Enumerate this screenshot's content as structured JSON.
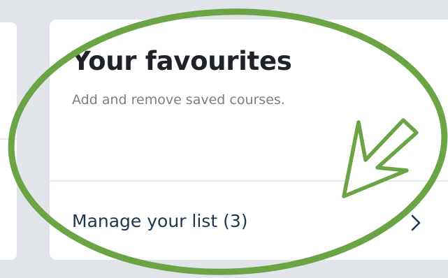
{
  "card": {
    "title": "Your favourites",
    "subtitle": "Add and remove saved courses.",
    "link_label": "Manage your list (3)"
  },
  "icons": {
    "link_chevron": "chevron-right-icon",
    "annotation_arrow": "arrow-icon"
  },
  "colors": {
    "background": "#e1e5ea",
    "card": "#ffffff",
    "title": "#1f2328",
    "subtitle": "#7a7f86",
    "link": "#1f3550",
    "annotation": "#6aa444"
  }
}
